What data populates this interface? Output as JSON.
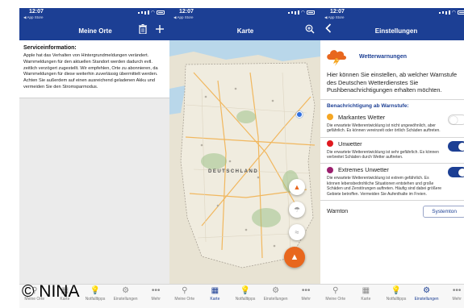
{
  "status": {
    "time": "12:07",
    "back_app": "◀ App Store"
  },
  "screen1": {
    "title": "Meine Orte",
    "info_heading": "Serviceinformation:",
    "info_text": "Apple hat das Verhalten von Hintergrundmeldungen verändert. Warnmeldungen für den aktuellen Standort werden dadurch evtl. zeitlich verzögert zugestellt. Wir empfehlen, Orte zu abonnieren, da Warnmeldungen für diese weiterhin zuverlässig übermittelt werden. Achten Sie außerdem auf einen ausreichend geladenen Akku und vermeiden Sie den Stromsparmodus."
  },
  "screen2": {
    "title": "Karte",
    "map_country": "DEUTSCHLAND"
  },
  "screen3": {
    "title": "Einstellungen",
    "warn_title": "Wetterwarnungen",
    "warn_desc": "Hier können Sie einstellen, ab welcher Warnstufe des Deutschen Wetterdienstes Sie Pushbenachrichtigungen erhalten möchten.",
    "section_head": "Benachrichtigung ab Warnstufe:",
    "levels": [
      {
        "name": "Markantes Wetter",
        "color": "#f5a623",
        "on": false,
        "desc": "Die erwartete Wetterentwicklung ist nicht ungewöhnlich, aber gefährlich. Es können vereinzelt oder örtlich Schäden auftreten."
      },
      {
        "name": "Unwetter",
        "color": "#e0191f",
        "on": true,
        "desc": "Die erwartete Wetterentwicklung ist sehr gefährlich. Es können verbreitet Schäden durch Wetter auftreten."
      },
      {
        "name": "Extremes Unwetter",
        "color": "#9b1f6e",
        "on": true,
        "desc": "Die erwartete Wetterentwicklung ist extrem gefährlich. Es können lebensbedrohliche Situationen entstehen und große Schäden und Zerstörungen auftreten. Häufig sind dabei größere Gebiete betroffen. Vermeiden Sie Aufenthalte im Freien."
      }
    ],
    "warnton_label": "Warnton",
    "warnton_button": "Systemton"
  },
  "tabs": [
    "Meine Orte",
    "Karte",
    "Notfalltipps",
    "Einstellungen",
    "Mehr"
  ],
  "tabs_partial": [
    "Meine Orte",
    "Karte",
    "Notfalltipps",
    "Einstellungen",
    "Mehr"
  ],
  "watermark": "© NINA",
  "colors": {
    "primary": "#1c3f94",
    "accent": "#e8671e"
  }
}
